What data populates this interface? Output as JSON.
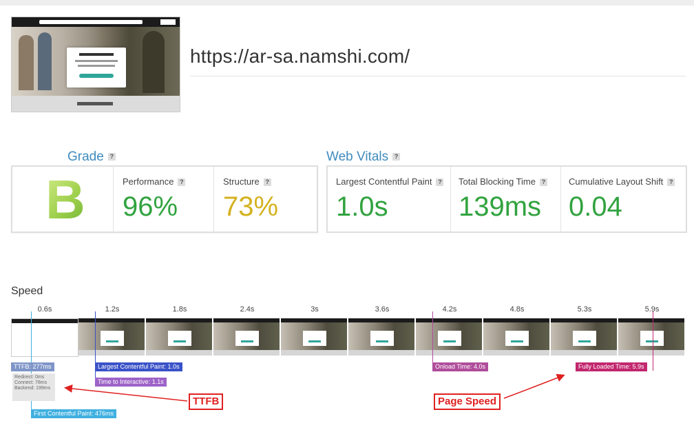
{
  "page": {
    "url": "https://ar-sa.namshi.com/"
  },
  "grade": {
    "title": "Grade",
    "help": "?",
    "letter": "B",
    "performance_label": "Performance",
    "performance_value": "96%",
    "structure_label": "Structure",
    "structure_value": "73%"
  },
  "vitals": {
    "title": "Web Vitals",
    "help": "?",
    "lcp_label": "Largest Contentful Paint",
    "lcp_value": "1.0s",
    "tbt_label": "Total Blocking Time",
    "tbt_value": "139ms",
    "cls_label": "Cumulative Layout Shift",
    "cls_value": "0.04"
  },
  "colors": {
    "accent_blue": "#3f8bbd",
    "good_green": "#31a33f",
    "warn_yellow": "#d4b21f",
    "annotation_red": "#e02020"
  },
  "speed": {
    "title": "Speed",
    "ticks": [
      "0.6s",
      "1.2s",
      "1.8s",
      "2.4s",
      "3s",
      "3.6s",
      "4.2s",
      "4.8s",
      "5.3s",
      "5.9s"
    ],
    "ttfb_tag": "TTFB: 277ms",
    "ttfb_detail": {
      "redirect": "Redirect: 0ms",
      "connect": "Connect: 78ms",
      "backend": "Backend: 199ms"
    },
    "lcp_tag": "Largest Contentful Paint: 1.0s",
    "tti_tag": "Time to Interactive: 1.1s",
    "fcp_tag": "First Contentful Paint: 476ms",
    "onload_tag": "Onload Time: 4.0s",
    "fully_loaded_tag": "Fully Loaded Time: 5.9s"
  },
  "annotations": {
    "ttfb": "TTFB",
    "page_speed": "Page Speed"
  }
}
